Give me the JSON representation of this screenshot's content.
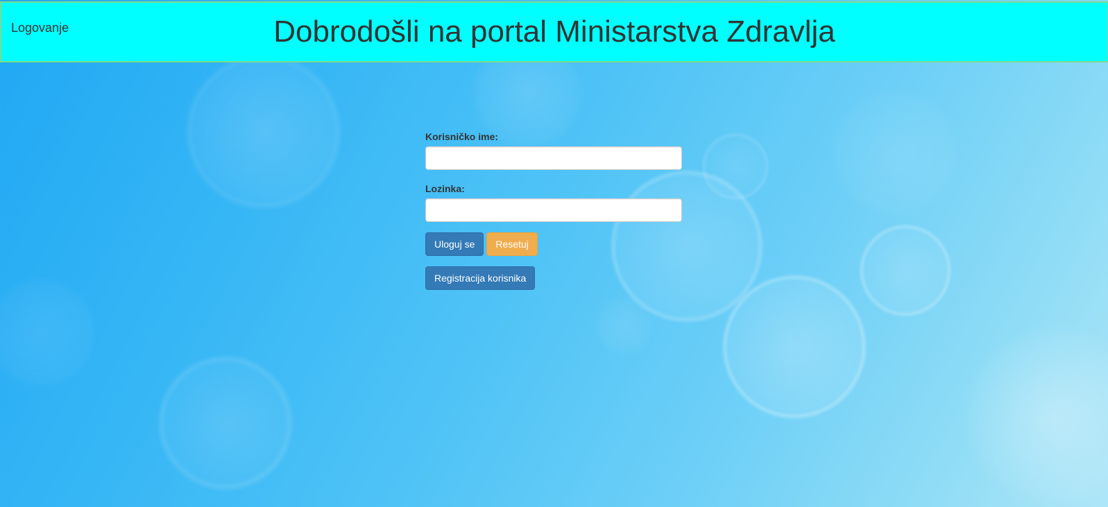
{
  "header": {
    "nav_link": "Logovanje",
    "title": "Dobrodošli na portal Ministarstva Zdravlja"
  },
  "login_form": {
    "username_label": "Korisničko ime:",
    "username_value": "",
    "password_label": "Lozinka:",
    "password_value": "",
    "login_button": "Uloguj se",
    "reset_button": "Resetuj",
    "register_button": "Registracija korisnika"
  },
  "colors": {
    "header_background": "#00ffff",
    "primary_button": "#337ab7",
    "warning_button": "#f0ad4e"
  }
}
